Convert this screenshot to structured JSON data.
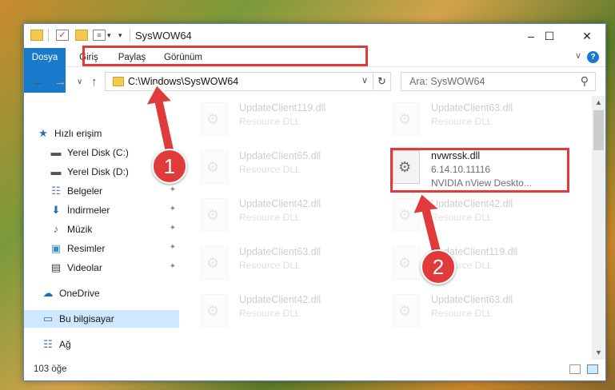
{
  "window": {
    "title": "SysWOW64",
    "minimize": "–",
    "maximize": "☐",
    "close": "✕"
  },
  "ribbon": {
    "tabs": [
      "Dosya",
      "Giriş",
      "Paylaş",
      "Görünüm"
    ],
    "help": "?",
    "collapse": "∨"
  },
  "nav": {
    "back": "←",
    "forward": "→",
    "recent": "∨",
    "up": "↑",
    "address": "C:\\Windows\\SysWOW64",
    "address_drop": "∨",
    "refresh": "↻",
    "search_placeholder": "Ara: SysWOW64",
    "search_icon": "⚲"
  },
  "sidebar": {
    "items": [
      {
        "label": "Hızlı erişim",
        "icon": "star-icon",
        "glyph": "★",
        "pinned": false
      },
      {
        "label": "Yerel Disk (C:)",
        "icon": "drive-icon",
        "glyph": "▬",
        "pinned": true
      },
      {
        "label": "Yerel Disk (D:)",
        "icon": "drive-icon",
        "glyph": "▬",
        "pinned": true
      },
      {
        "label": "Belgeler",
        "icon": "documents-icon",
        "glyph": "☷",
        "pinned": true
      },
      {
        "label": "İndirmeler",
        "icon": "download-icon",
        "glyph": "⬇",
        "pinned": true
      },
      {
        "label": "Müzik",
        "icon": "music-icon",
        "glyph": "♪",
        "pinned": true
      },
      {
        "label": "Resimler",
        "icon": "pictures-icon",
        "glyph": "▣",
        "pinned": true
      },
      {
        "label": "Videolar",
        "icon": "videos-icon",
        "glyph": "▤",
        "pinned": true
      },
      {
        "label": "OneDrive",
        "icon": "onedrive-icon",
        "glyph": "☁",
        "pinned": false
      },
      {
        "label": "Bu bilgisayar",
        "icon": "computer-icon",
        "glyph": "▭",
        "pinned": false,
        "selected": true
      },
      {
        "label": "Ağ",
        "icon": "network-icon",
        "glyph": "☷",
        "pinned": false
      }
    ],
    "pin_glyph": "📌"
  },
  "files": [
    {
      "name": "UpdateClient119.dll",
      "desc": "Resource DLL",
      "faded": true
    },
    {
      "name": "UpdateClient63.dll",
      "desc": "Resource DLL",
      "faded": true
    },
    {
      "name": "UpdateClient65.dll",
      "desc": "Resource DLL",
      "faded": true
    },
    {
      "name": "nvwrssk.dll",
      "desc": "6.14.10.11116",
      "desc2": "NVIDIA nView Deskto...",
      "faded": false
    },
    {
      "name": "UpdateClient42.dll",
      "desc": "Resource DLL",
      "faded": true
    },
    {
      "name": "UpdateClient42.dll",
      "desc": "Resource DLL",
      "faded": true
    },
    {
      "name": "UpdateClient63.dll",
      "desc": "Resource DLL",
      "faded": true
    },
    {
      "name": "UpdateClient119.dll",
      "desc": "Resource DLL",
      "faded": true
    },
    {
      "name": "UpdateClient42.dll",
      "desc": "Resource DLL",
      "faded": true
    },
    {
      "name": "UpdateClient63.dll",
      "desc": "Resource DLL",
      "faded": true
    }
  ],
  "status": {
    "count": "103 öğe"
  },
  "annotations": {
    "step1": "1",
    "step2": "2",
    "color": "#e03a3a"
  }
}
